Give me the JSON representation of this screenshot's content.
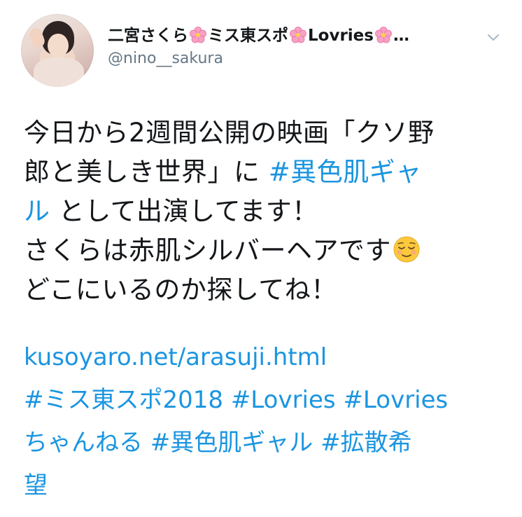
{
  "user": {
    "display_name_parts": [
      "二宮さくら",
      "ミス東スポ",
      "Lovries",
      "…"
    ],
    "handle": "@nino__sakura",
    "avatar_icon": "profile-photo",
    "flower_icon": "cherry-blossom-emoji",
    "menu_icon": "chevron-down-icon"
  },
  "tweet": {
    "line1": "今日から2週間公開の映画「クソ野",
    "line2_text": "郎と美しき世界」に ",
    "line2_hashtag": "#異色肌ギャ",
    "line3_hashtag": "ル",
    "line3_text": " として出演してます！",
    "line4": "さくらは赤肌シルバーヘアです",
    "line4_emoji": "relieved-face-emoji",
    "line5": "どこにいるのか探してね！"
  },
  "links": {
    "url": "kusoyaro.net/arasuji.html",
    "line2": "#ミス東スポ2018 #Lovries #Lovries",
    "line3": "ちゃんねる #異色肌ギャル #拡散希",
    "line4": "望"
  },
  "colors": {
    "link": "#1b95e0",
    "text": "#14171a",
    "muted": "#657786"
  }
}
